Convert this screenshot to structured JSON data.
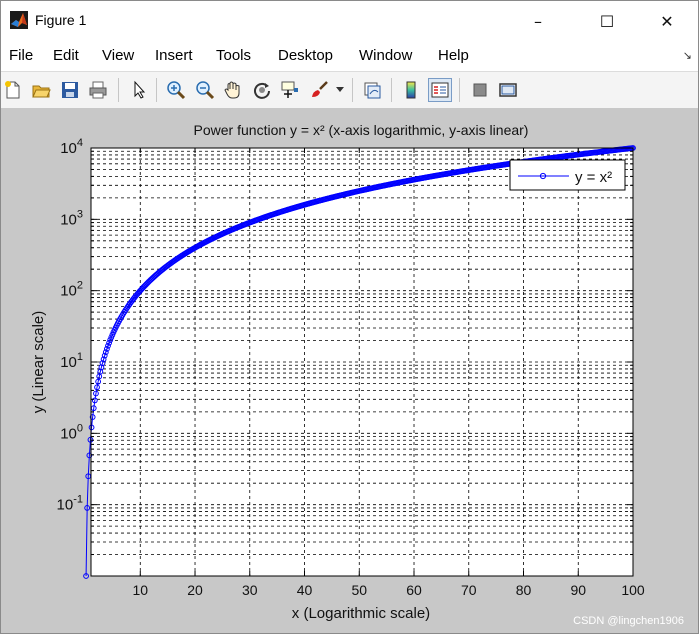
{
  "window": {
    "title": "Figure 1",
    "controls": {
      "minimize": "–",
      "maximize": "☐",
      "close": "✕"
    }
  },
  "menu": {
    "items": [
      "File",
      "Edit",
      "View",
      "Insert",
      "Tools",
      "Desktop",
      "Window",
      "Help"
    ],
    "dock_arrow": "↘"
  },
  "toolbar": {
    "icons": [
      "new-figure-icon",
      "open-file-icon",
      "save-icon",
      "print-icon",
      "edit-plot-arrow-icon",
      "zoom-in-icon",
      "zoom-out-icon",
      "pan-hand-icon",
      "rotate-3d-icon",
      "data-cursor-icon",
      "brush-icon",
      "brush-dropdown-icon",
      "link-plot-icon",
      "insert-colorbar-icon",
      "insert-legend-icon",
      "hide-plot-tools-icon",
      "show-plot-tools-icon"
    ]
  },
  "colors": {
    "series": "#0000ff",
    "axes_bg": "#ffffff",
    "figure_bg": "#c8c8c8",
    "grid": "#000000"
  },
  "chart_data": {
    "type": "line",
    "title": "Power function y = x² (x-axis logarithmic, y-axis linear)",
    "xlabel": "x (Logarithmic scale)",
    "ylabel": "y (Linear scale)",
    "x_scale": "linear",
    "y_scale": "log",
    "xlim": [
      1,
      100
    ],
    "ylim": [
      0.01,
      10000
    ],
    "xticks": [
      10,
      20,
      30,
      40,
      50,
      60,
      70,
      80,
      90,
      100
    ],
    "xtick_labels": [
      "10",
      "20",
      "30",
      "40",
      "50",
      "60",
      "70",
      "80",
      "90",
      "100"
    ],
    "yticks": [
      0.1,
      1,
      10,
      100,
      1000,
      10000
    ],
    "ytick_labels": [
      {
        "base": "10",
        "exp": "-1"
      },
      {
        "base": "10",
        "exp": "0"
      },
      {
        "base": "10",
        "exp": "1"
      },
      {
        "base": "10",
        "exp": "2"
      },
      {
        "base": "10",
        "exp": "3"
      },
      {
        "base": "10",
        "exp": "4"
      }
    ],
    "grid": true,
    "minor_grid_y": true,
    "legend": {
      "location": "top-right",
      "entries": [
        "y = x²"
      ]
    },
    "series": [
      {
        "name": "y = x²",
        "color": "#0000ff",
        "marker": "circle",
        "function": "y = x^2",
        "x_range": [
          0.1,
          100
        ],
        "points": 500
      }
    ]
  },
  "watermark": "CSDN @lingchen1906"
}
